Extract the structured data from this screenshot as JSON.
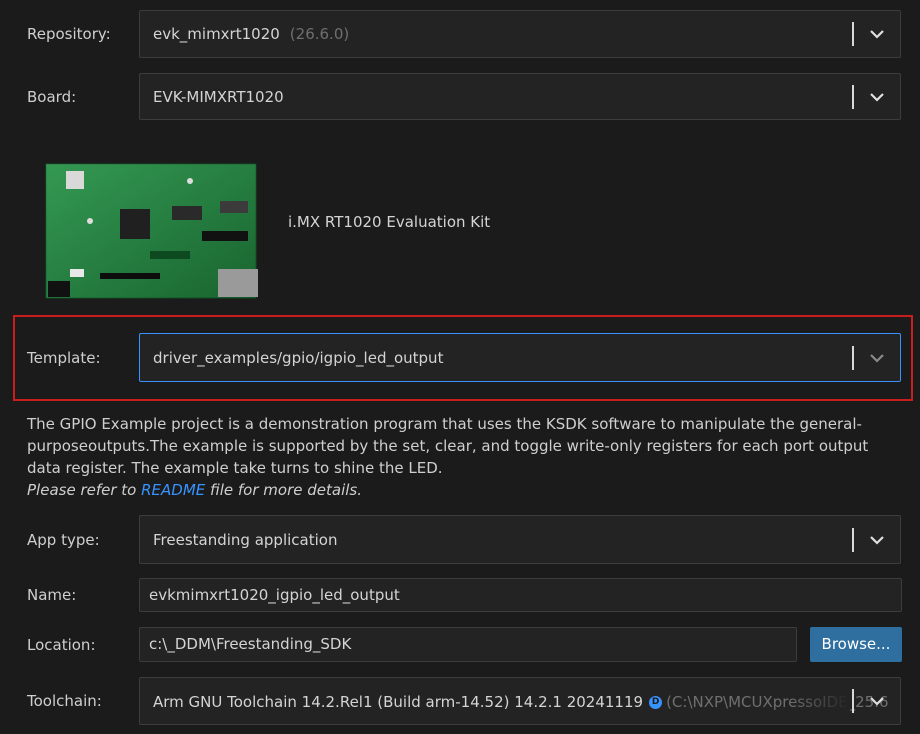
{
  "repository": {
    "label": "Repository:",
    "value": "evk_mimxrt1020",
    "version": "(26.6.0)"
  },
  "board": {
    "label": "Board:",
    "value": "EVK-MIMXRT1020",
    "kit_name": "i.MX RT1020 Evaluation Kit"
  },
  "template": {
    "label": "Template:",
    "value": "driver_examples/gpio/igpio_led_output"
  },
  "description": {
    "text": "The GPIO Example project is a demonstration program that uses the KSDK software to manipulate the general-purposeoutputs.The example is supported by the set, clear, and toggle write-only registers for each port output data register. The example take turns to shine the LED.",
    "ref_prefix": "Please refer to",
    "ref_link": "README",
    "ref_suffix": "file for more details."
  },
  "app_type": {
    "label": "App type:",
    "value": "Freestanding application"
  },
  "name": {
    "label": "Name:",
    "value": "evkmimxrt1020_igpio_led_output"
  },
  "location": {
    "label": "Location:",
    "value": "c:\\_DDM\\Freestanding_SDK",
    "browse_label": "Browse..."
  },
  "toolchain": {
    "label": "Toolchain:",
    "value": "Arm GNU Toolchain 14.2.Rel1 (Build arm-14.52) 14.2.1 20241119",
    "badge": "D",
    "path": "(C:\\NXP\\MCUXpressoIDE_25.6"
  },
  "icons": {
    "chevron": "chevron-down-icon",
    "info": "info-bubble-icon"
  },
  "colors": {
    "highlight": "#c81e1e",
    "link": "#3794ff",
    "button": "#2f6f9f",
    "focus_border": "#3794ff"
  }
}
